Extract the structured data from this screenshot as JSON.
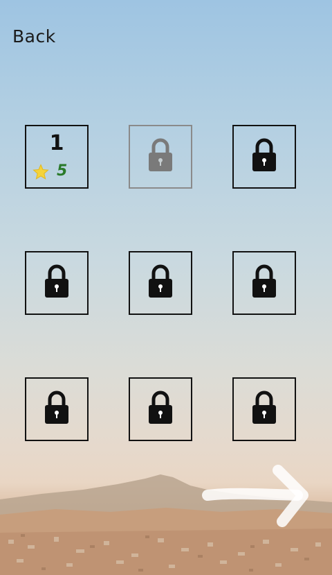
{
  "header": {
    "back_label": "Back"
  },
  "levels": [
    {
      "number": "1",
      "stars": "5",
      "locked": false
    },
    {
      "locked": true,
      "dimmed": true
    },
    {
      "locked": true
    },
    {
      "locked": true
    },
    {
      "locked": true
    },
    {
      "locked": true
    },
    {
      "locked": true
    },
    {
      "locked": true
    },
    {
      "locked": true
    }
  ],
  "icons": {
    "back": "text-link",
    "star": "star-icon",
    "lock": "lock-icon",
    "next": "arrow-right-icon"
  },
  "colors": {
    "star": "#f5d33a",
    "stars_count": "#2a7a2a",
    "lock_locked": "#111111",
    "lock_dimmed": "#7a7a7a",
    "tile_border": "#111111",
    "tile_border_dimmed": "#8a8a8a"
  }
}
